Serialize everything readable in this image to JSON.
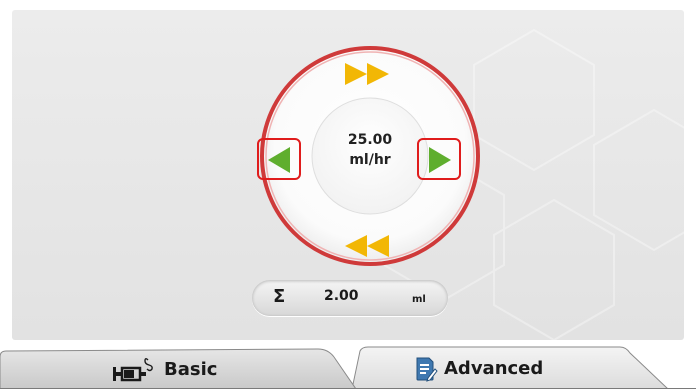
{
  "rate": {
    "value": "25.00",
    "unit": "ml/hr"
  },
  "total": {
    "symbol": "Σ",
    "value": "2.00",
    "unit": "ml"
  },
  "controls": {
    "fast_increase_icon": "double-triangle-up-icon",
    "fast_decrease_icon": "double-triangle-down-icon",
    "increase_icon": "triangle-right-icon",
    "decrease_icon": "triangle-left-icon"
  },
  "tabs": [
    {
      "label": "Basic",
      "icon": "syringe-icon",
      "selected": true
    },
    {
      "label": "Advanced",
      "icon": "document-edit-icon",
      "selected": false
    }
  ],
  "colors": {
    "ring_red": "#cf3a3a",
    "fast_arrow_yellow": "#f2b705",
    "step_arrow_green": "#5fae2e",
    "selection_red": "#e01c1c"
  }
}
